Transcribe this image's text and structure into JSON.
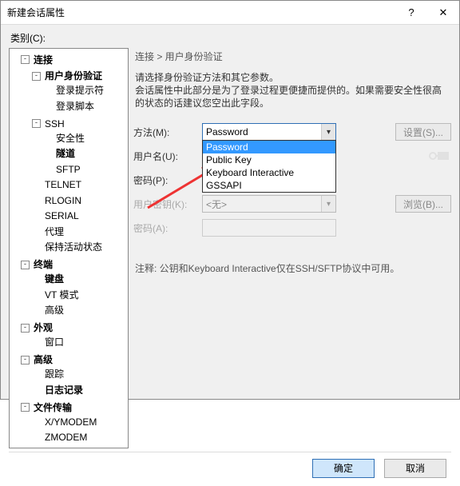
{
  "window": {
    "title": "新建会话属性"
  },
  "category_label": "类别(C):",
  "tree": {
    "connection": "连接",
    "user_auth": "用户身份验证",
    "login_prompt": "登录提示符",
    "login_script": "登录脚本",
    "ssh": "SSH",
    "security": "安全性",
    "tunnel": "隧道",
    "sftp": "SFTP",
    "telnet": "TELNET",
    "rlogin": "RLOGIN",
    "serial": "SERIAL",
    "proxy": "代理",
    "keepalive": "保持活动状态",
    "terminal": "终端",
    "keyboard": "键盘",
    "vt": "VT 模式",
    "advanced_term": "高级",
    "appearance": "外观",
    "window_item": "窗口",
    "advanced": "高级",
    "trace": "跟踪",
    "logging": "日志记录",
    "filetransfer": "文件传输",
    "xymodem": "X/YMODEM",
    "zmodem": "ZMODEM"
  },
  "breadcrumb": "连接 > 用户身份验证",
  "desc_line1": "请选择身份验证方法和其它参数。",
  "desc_line2": "会话属性中此部分是为了登录过程更便捷而提供的。如果需要安全性很高的状态的话建议您空出此字段。",
  "form": {
    "method_label": "方法(M):",
    "method_value": "Password",
    "method_options": [
      "Password",
      "Public Key",
      "Keyboard Interactive",
      "GSSAPI"
    ],
    "user_label": "用户名(U):",
    "user_value": "",
    "password_label": "密码(P):",
    "password_value": "",
    "userkey_label": "用户密钥(K):",
    "userkey_value": "<无>",
    "passphrase_label": "密码(A):",
    "passphrase_value": "",
    "settings_btn": "设置(S)...",
    "browse_btn": "浏览(B)..."
  },
  "note": "注释: 公钥和Keyboard Interactive仅在SSH/SFTP协议中可用。",
  "buttons": {
    "ok": "确定",
    "cancel": "取消"
  }
}
